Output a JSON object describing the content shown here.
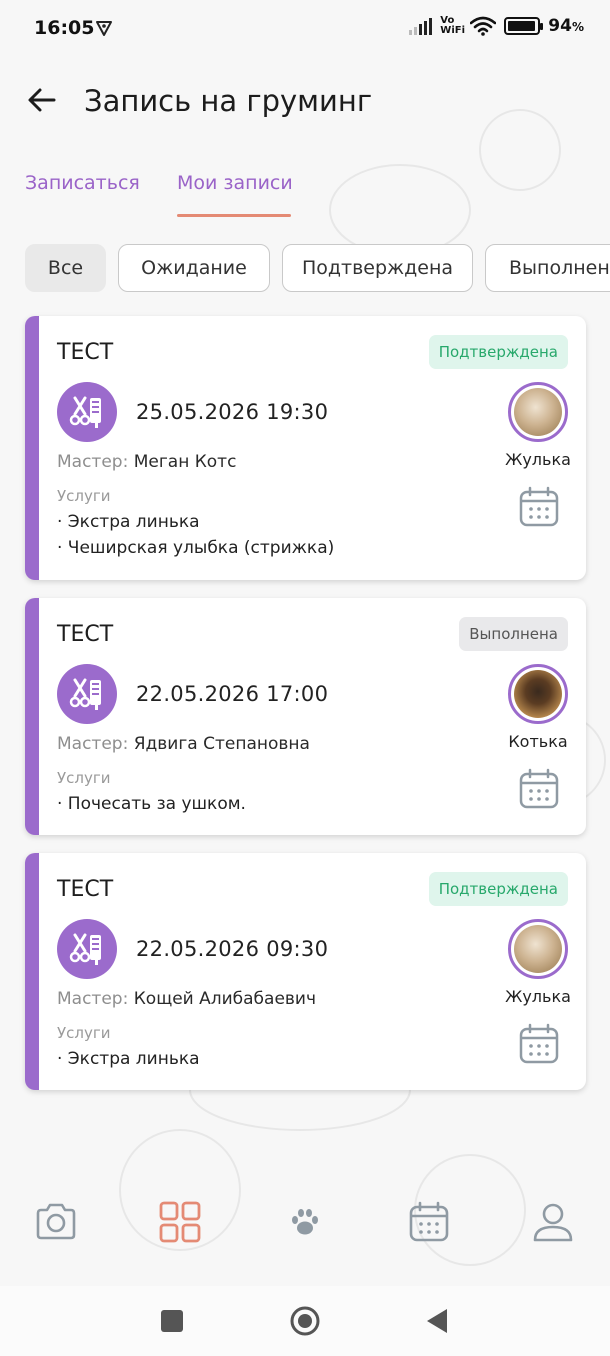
{
  "status_bar": {
    "time": "16:05",
    "network": "Vo WiFi",
    "battery": "94",
    "battery_unit": "%",
    "battery_level": 0.94
  },
  "header": {
    "title": "Запись на груминг"
  },
  "tabs": [
    {
      "label": "Записаться",
      "active": false
    },
    {
      "label": "Мои записи",
      "active": true
    }
  ],
  "filters": [
    {
      "label": "Все",
      "active": true
    },
    {
      "label": "Ожидание",
      "active": false
    },
    {
      "label": "Подтверждена",
      "active": false
    },
    {
      "label": "Выполнена",
      "active": false
    }
  ],
  "labels": {
    "master": "Мастер:",
    "services": "Услуги"
  },
  "appointments": [
    {
      "title": "ТЕСТ",
      "status": "Подтверждена",
      "datetime": "25.05.2026 19:30",
      "master": "Меган Котс",
      "pet": "Жулька",
      "services": [
        "· Экстра линька",
        "· Чеширская улыбка (стрижка)"
      ]
    },
    {
      "title": "ТЕСТ",
      "status": "Выполнена",
      "datetime": "22.05.2026 17:00",
      "master": "Ядвига Степановна",
      "pet": "Котька",
      "services": [
        "· Почесать за ушком."
      ]
    },
    {
      "title": "ТЕСТ",
      "status": "Подтверждена",
      "datetime": "22.05.2026 09:30",
      "master": "Кощей Алибабаевич",
      "pet": "Жулька",
      "services": [
        "· Экстра линька"
      ]
    }
  ],
  "bottom_nav": [
    {
      "icon": "camera-icon",
      "active": false
    },
    {
      "icon": "grid-icon",
      "active": true
    },
    {
      "icon": "paw-icon",
      "active": false
    },
    {
      "icon": "calendar-icon",
      "active": false
    },
    {
      "icon": "profile-icon",
      "active": false
    }
  ],
  "colors": {
    "accent_purple": "#9b6bcc",
    "tab_underline": "#e48a74",
    "active_nav": "#e48a74",
    "confirmed_text": "#27a86b",
    "confirmed_bg": "#dff5ec",
    "done_bg": "#e9e9eb"
  }
}
